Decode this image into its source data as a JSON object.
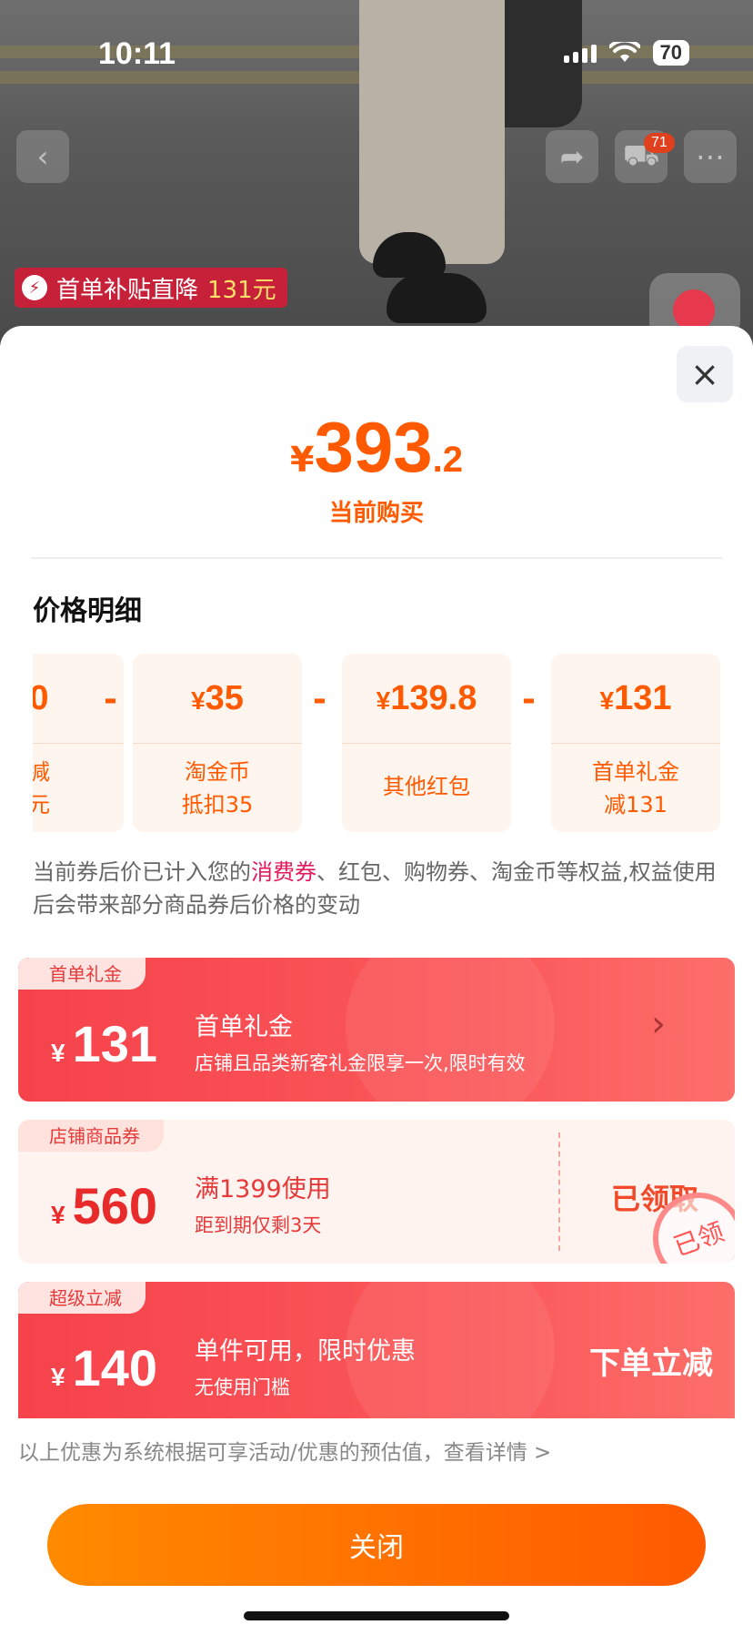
{
  "status_bar": {
    "time": "10:11",
    "battery": "70"
  },
  "product_top": {
    "cart_badge": "71",
    "promo_label": "首单补贴直降",
    "promo_amount": "131元"
  },
  "sheet": {
    "close_icon": "×",
    "price": {
      "symbol": "¥",
      "integer": "393",
      "decimal": ".2"
    },
    "price_subtitle": "当前购买",
    "section_title": "价格明细",
    "breakdown": [
      {
        "value_symbol": "",
        "value": "0",
        "line1": "减",
        "line2": "元"
      },
      {
        "value_symbol": "¥",
        "value": "35",
        "line1": "淘金币",
        "line2": "抵扣35"
      },
      {
        "value_symbol": "¥",
        "value": "139.8",
        "line1": "其他红包",
        "line2": ""
      },
      {
        "value_symbol": "¥",
        "value": "131",
        "line1": "首单礼金",
        "line2": "减131"
      }
    ],
    "minus_sign": "-",
    "note_prefix": "当前券后价已计入您的",
    "note_highlight": "消费券",
    "note_suffix": "、红包、购物券、淘金币等权益,权益使用后会带来部分商品券后价格的变动",
    "coupons": [
      {
        "tag": "首单礼金",
        "symbol": "¥",
        "amount": "131",
        "title": "首单礼金",
        "desc": "店铺且品类新客礼金限享一次,限时有效",
        "right": "›"
      },
      {
        "tag": "店铺商品券",
        "symbol": "¥",
        "amount": "560",
        "title": "满1399使用",
        "desc": "距到期仅剩3天",
        "right": "已领取",
        "stamp": "已领"
      },
      {
        "tag": "超级立减",
        "symbol": "¥",
        "amount": "140",
        "title": "单件可用，限时优惠",
        "desc": "无使用门槛",
        "right": "下单立减"
      }
    ],
    "footnote": "以上优惠为系统根据可享活动/优惠的预估值，查看详情 >",
    "close_button": "关闭"
  },
  "colors": {
    "accent": "#ff5a00",
    "coupon_red": "#f6424b",
    "highlight": "#e0195a"
  }
}
